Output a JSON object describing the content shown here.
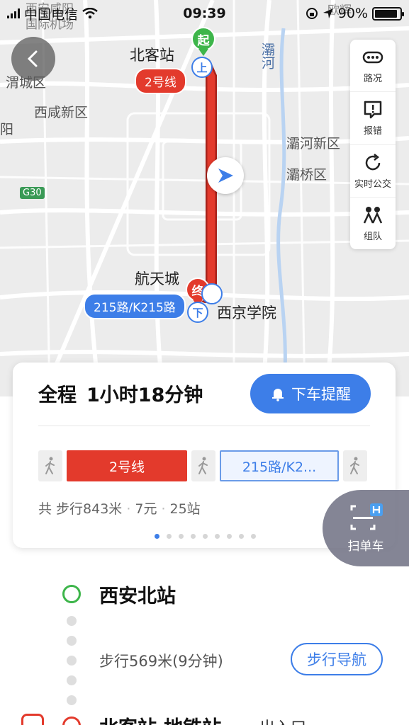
{
  "status_bar": {
    "carrier": "中国电信",
    "time": "09:39",
    "battery": "90%",
    "battery_level": 0.9
  },
  "map": {
    "labels": {
      "airport": "西安咸阳\n国际机场",
      "beikezhan": "北客站",
      "weicheng": "渭城区",
      "xixian": "西咸新区",
      "yang": "阳",
      "bahe": "灞河",
      "baheqixin": "灞河新区",
      "baqiao": "灞桥区",
      "hangtian": "航天城",
      "xijing": "西京学院",
      "g30": "G30",
      "ouhui": "欧辉"
    },
    "route_tags": {
      "line2": "2号线",
      "bus": "215路/K215路"
    },
    "markers": {
      "start": "起",
      "end": "终",
      "board": "上",
      "alight": "下"
    },
    "colors": {
      "route_red": "#e33a2c",
      "accent_blue": "#3d7ee8",
      "start_green": "#3db54a"
    }
  },
  "toolbar": {
    "items": [
      {
        "label": "路况",
        "icon": "traffic-icon"
      },
      {
        "label": "报错",
        "icon": "report-icon"
      },
      {
        "label": "实时公交",
        "icon": "refresh-icon"
      },
      {
        "label": "组队",
        "icon": "team-icon"
      }
    ]
  },
  "card": {
    "total_label": "全程",
    "duration": "1小时18分钟",
    "remind_button": "下车提醒",
    "segments": {
      "line2": "2号线",
      "bus": "215路/K2..."
    },
    "summary": {
      "walk": "共 步行843米",
      "fare": "7元",
      "stops": "25站",
      "sep": "·"
    },
    "page_count": 9,
    "active_page": 1
  },
  "scan_bike": {
    "label": "扫单车"
  },
  "steps": {
    "station_start": "西安北站",
    "walk_text": "步行569米(9分钟)",
    "walk_nav_button": "步行导航",
    "station_next": "北客站·地铁站",
    "exit_text": "出入口"
  }
}
